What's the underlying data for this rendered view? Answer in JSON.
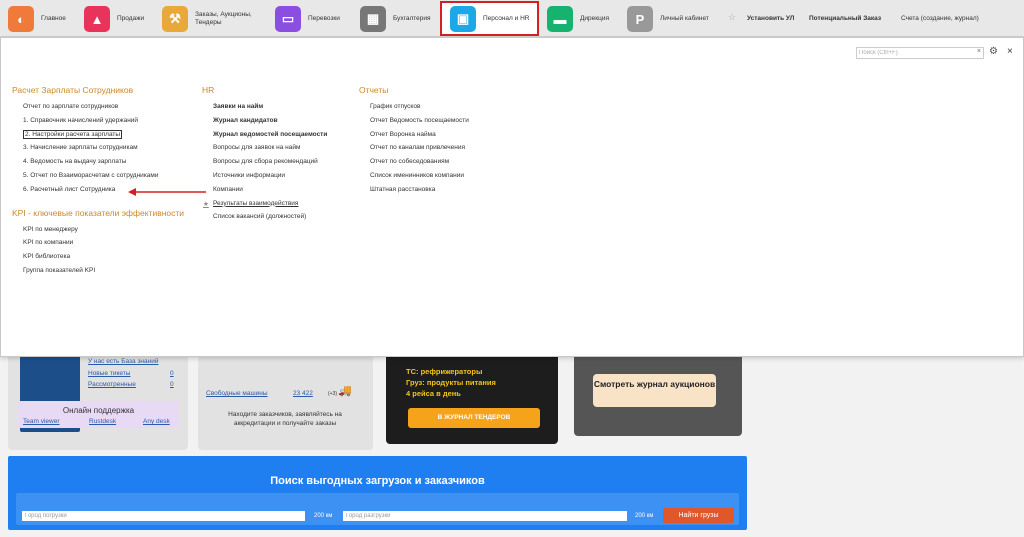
{
  "topnav": [
    {
      "label": "Главное",
      "icon": "logo-icon",
      "color": "#f07a3a"
    },
    {
      "label": "Продажи",
      "icon": "chart-icon",
      "color": "#e8335a"
    },
    {
      "label": "Заказы, Аукционы, Тендеры",
      "icon": "gavel-icon",
      "color": "#e9a93a"
    },
    {
      "label": "Перевозки",
      "icon": "truck-icon",
      "color": "#8a4fe0"
    },
    {
      "label": "Бухгалтерия",
      "icon": "calculator-icon",
      "color": "#777777"
    },
    {
      "label": "Персонал и HR",
      "icon": "id-card-icon",
      "color": "#1aa8e6"
    },
    {
      "label": "Дирекция",
      "icon": "wallet-icon",
      "color": "#16b36e"
    },
    {
      "label": "Личный кабинет",
      "icon": "parking-icon",
      "color": "#999999"
    }
  ],
  "toolbar": {
    "install": "Установить УЛ",
    "potential": "Потенциальный Заказ",
    "invoices": "Счета (создание, журнал)"
  },
  "search": {
    "placeholder": "Поиск (Ctrl+F)"
  },
  "columns": [
    {
      "sections": [
        {
          "title": "Расчет Зарплаты Сотрудников",
          "items": [
            "Отчет по зарплате сотрудников",
            "1. Справочник начислений удержаний",
            "2. Настройки расчета зарплаты",
            "3. Начисление зарплаты сотрудникам",
            "4. Ведомость на выдачу зарплаты",
            "5. Отчет по Взаиморасчетам с сотрудниками",
            "6. Расчетный лист Сотрудника"
          ]
        },
        {
          "title": "KPI - ключевые показатели эффективности",
          "items": [
            "KPI по менеджеру",
            "KPI по компании",
            "KPI библиотека",
            "Группа показателей KPI"
          ]
        }
      ]
    },
    {
      "sections": [
        {
          "title": "HR",
          "items": [
            "Заявки на найм",
            "Журнал кандидатов",
            "Журнал ведомостей посещаемости",
            "Вопросы для заявок на найм",
            "Вопросы для сбора рекомендаций",
            "Источники информации",
            "Компании",
            "Результаты взаимодействия",
            "Список вакансий (должностей)"
          ]
        }
      ]
    },
    {
      "sections": [
        {
          "title": "Отчеты",
          "items": [
            "График отпусков",
            "Отчет Ведомость посещаемости",
            "Отчет Воронка найма",
            "Отчет по каналам привлечения",
            "Отчет по собеседованиям",
            "Список именинников компании",
            "Штатная расстановка"
          ]
        }
      ]
    }
  ],
  "background": {
    "kb_link": "У нас есть База знаний",
    "new_tickets": "Новые тикеты",
    "new_tickets_count": "0",
    "viewed": "Рассмотренные",
    "viewed_count": "0",
    "support_title": "Онлайн поддержка",
    "support_links": [
      "Team viewer",
      "Rustdesk",
      "Any desk"
    ],
    "free_trucks": "Свободные машины",
    "free_trucks_count": "23 422",
    "free_trucks_delta": "(+3)",
    "customers_text": "Находите заказчиков, заявляйтесь на аккредитации и получайте заказы",
    "promo_tc": "ТС: рефрижераторы",
    "promo_cargo": "Груз: продукты питания",
    "promo_trips": "4 рейса в день",
    "promo_btn": "В ЖУРНАЛ ТЕНДЕРОВ",
    "auction_btn": "Смотреть журнал аукционов"
  },
  "loadsearch": {
    "title": "Поиск выгодных загрузок и заказчиков",
    "from_placeholder": "Город погрузки",
    "to_placeholder": "Город разгрузки",
    "radius1": "200 км",
    "radius2": "200 км",
    "button": "Найти грузы"
  }
}
